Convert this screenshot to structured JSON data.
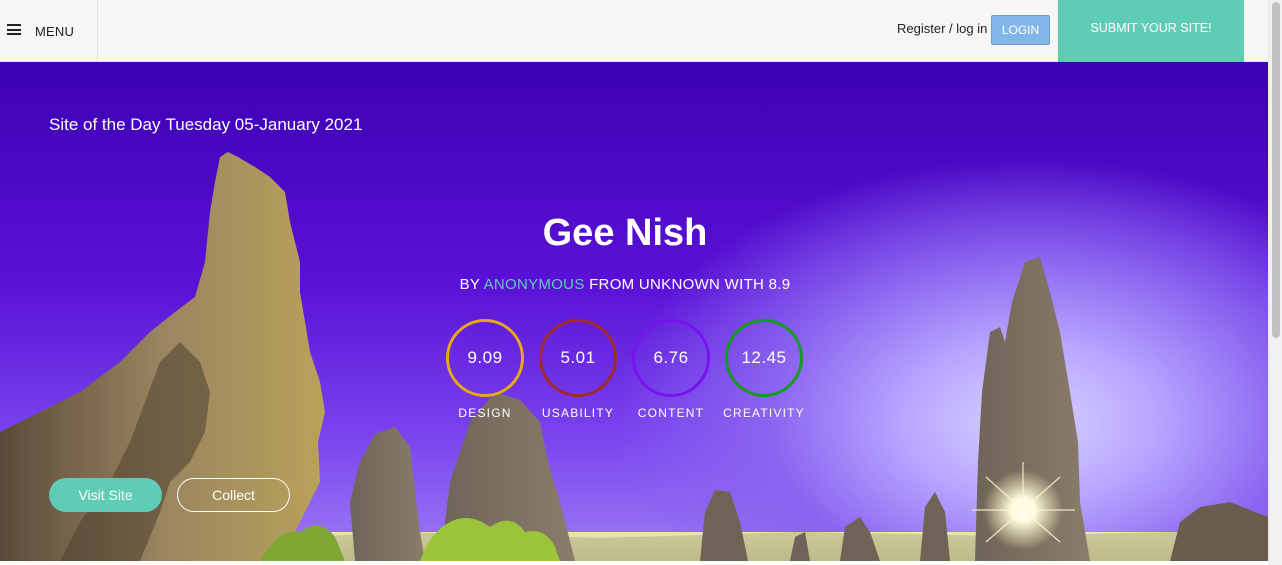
{
  "header": {
    "menu_label": "MENU",
    "menu_icon": "hamburger-icon",
    "register_label": "Register / log in",
    "login_label": "LOGIN",
    "submit_label": "SUBMIT YOUR SITE!"
  },
  "hero": {
    "award": "Site of the Day",
    "date": "Tuesday 05-January 2021",
    "title": "Gee Nish",
    "by_prefix": "BY",
    "author": "ANONYMOUS",
    "by_suffix": "FROM UNKNOWN WITH 8.9",
    "scores": [
      {
        "value": "9.09",
        "label": "DESIGN",
        "color": "#e6a817"
      },
      {
        "value": "5.01",
        "label": "USABILITY",
        "color": "#a12a2a"
      },
      {
        "value": "6.76",
        "label": "CONTENT",
        "color": "#7a12f0"
      },
      {
        "value": "12.45",
        "label": "CREATIVITY",
        "color": "#149a1e"
      }
    ],
    "visit_label": "Visit Site",
    "collect_label": "Collect"
  },
  "colors": {
    "accent": "#5fcdb5",
    "login": "#83b6e8"
  }
}
